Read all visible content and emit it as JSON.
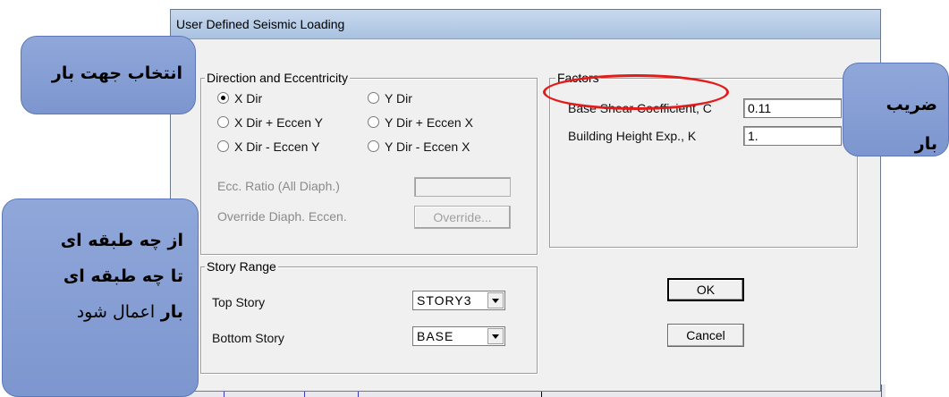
{
  "window": {
    "title": "User Defined Seismic Loading"
  },
  "direction_group": {
    "legend": "Direction and Eccentricity",
    "options": [
      {
        "label": "X Dir",
        "checked": true
      },
      {
        "label": "Y Dir",
        "checked": false
      },
      {
        "label": "X Dir + Eccen Y",
        "checked": false
      },
      {
        "label": "Y Dir + Eccen X",
        "checked": false
      },
      {
        "label": "X Dir - Eccen Y",
        "checked": false
      },
      {
        "label": "Y Dir - Eccen X",
        "checked": false
      }
    ],
    "ecc_ratio_label": "Ecc. Ratio (All Diaph.)",
    "ecc_ratio_value": "",
    "override_label": "Override Diaph. Eccen.",
    "override_button": "Override..."
  },
  "factors_group": {
    "legend": "Factors",
    "base_shear_label": "Base Shear Coefficient, C",
    "base_shear_value": "0.11",
    "height_exp_label": "Building Height Exp., K",
    "height_exp_value": "1."
  },
  "story_range_group": {
    "legend": "Story Range",
    "top_story_label": "Top Story",
    "top_story_value": "STORY3",
    "bottom_story_label": "Bottom Story",
    "bottom_story_value": "BASE"
  },
  "buttons": {
    "ok": "OK",
    "cancel": "Cancel"
  },
  "callouts": {
    "direction": "انتخاب جهت بار",
    "story_line1": "از چه طبقه ای",
    "story_line2": "تا چه طبقه ای",
    "story_line3_bold": "بار",
    "story_line3_normal": "اعمال شود",
    "coefficient_line1": "ضریب",
    "coefficient_line2": "بار"
  },
  "colors": {
    "highlight_ring": "#e21b1b",
    "callout_fill": "#8fa7d9",
    "titlebar": "#b9cde6"
  }
}
